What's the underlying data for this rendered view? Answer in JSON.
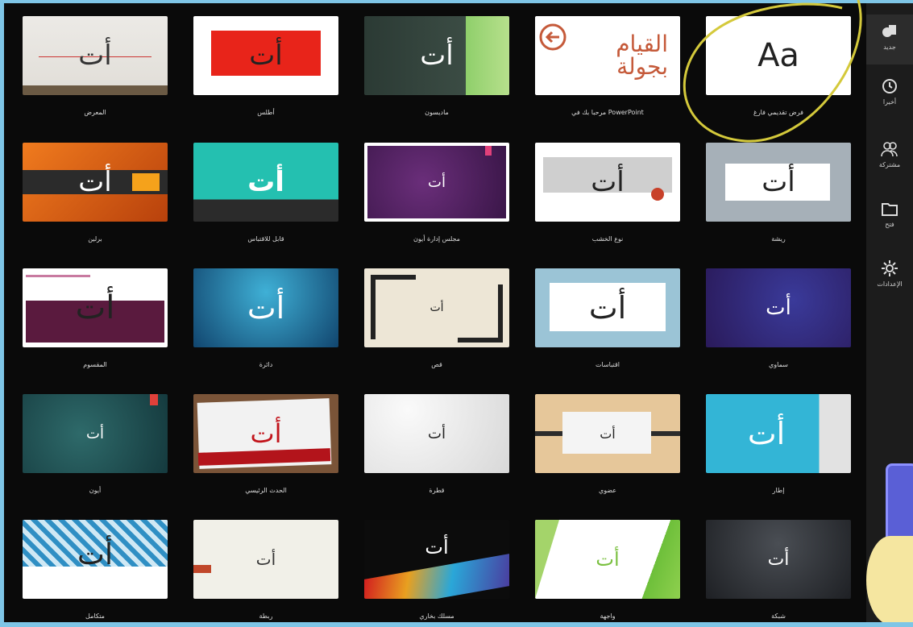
{
  "colors": {
    "frame": "#7ec5e6",
    "background": "#0a0a0a",
    "sidebar": "#1c1c1c",
    "highlight_marker": "#d4c93b"
  },
  "sidebar": {
    "items": [
      {
        "label": "جديد",
        "icon": "new-presentation-icon"
      },
      {
        "label": "أخيرا",
        "icon": "clock-icon"
      },
      {
        "label": "مشتركة",
        "icon": "people-icon"
      },
      {
        "label": "فتح",
        "icon": "folder-icon"
      },
      {
        "label": "الإعدادات",
        "icon": "gear-icon"
      }
    ]
  },
  "templates": [
    {
      "label": "فرض تقديمي فارغ",
      "thumb": "Aa"
    },
    {
      "label": "مرحبا بك في PowerPoint",
      "thumb": "القيام بجولة"
    },
    {
      "label": "ماديسون",
      "thumb": "أت"
    },
    {
      "label": "أطلس",
      "thumb": "أت"
    },
    {
      "label": "المعرض",
      "thumb": "أت"
    },
    {
      "label": "ريشة",
      "thumb": "أت"
    },
    {
      "label": "نوع الخشب",
      "thumb": "أت"
    },
    {
      "label": "مجلس إدارة أيون",
      "thumb": "أت"
    },
    {
      "label": "قابل للاقتباس",
      "thumb": "أت"
    },
    {
      "label": "برلين",
      "thumb": "أت"
    },
    {
      "label": "سماوي",
      "thumb": "أت"
    },
    {
      "label": "اقتباسات",
      "thumb": "أت"
    },
    {
      "label": "قص",
      "thumb": "أت"
    },
    {
      "label": "دائرة",
      "thumb": "أت"
    },
    {
      "label": "المقسوم",
      "thumb": "أت"
    },
    {
      "label": "إطار",
      "thumb": "أت"
    },
    {
      "label": "عضوي",
      "thumb": "أت"
    },
    {
      "label": "قطرة",
      "thumb": "أت"
    },
    {
      "label": "الحدث الرئيسي",
      "thumb": "أت"
    },
    {
      "label": "أيون",
      "thumb": "أت"
    },
    {
      "label": "شبكة",
      "thumb": "أت"
    },
    {
      "label": "واجهة",
      "thumb": "أت"
    },
    {
      "label": "مسلك بخاري",
      "thumb": "أت"
    },
    {
      "label": "ربطة",
      "thumb": "أت"
    },
    {
      "label": "متكامل",
      "thumb": "أت"
    }
  ]
}
